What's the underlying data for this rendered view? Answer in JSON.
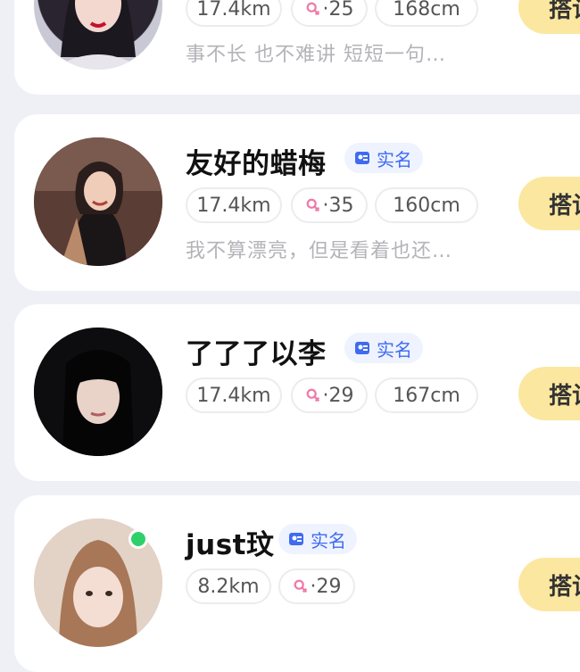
{
  "profiles": [
    {
      "name": "",
      "verified_label": "",
      "distance": "17.4km",
      "age": "25",
      "height": "168cm",
      "bio": "事不长 也不难讲 短短一句…",
      "button_label": "搭讪"
    },
    {
      "name": "友好的蜡梅",
      "verified_label": "实名",
      "distance": "17.4km",
      "age": "35",
      "height": "160cm",
      "bio": "我不算漂亮，但是看着也还…",
      "button_label": "搭讪"
    },
    {
      "name": "了了了以李",
      "verified_label": "实名",
      "distance": "17.4km",
      "age": "29",
      "height": "167cm",
      "bio": "",
      "button_label": "搭讪"
    },
    {
      "name": "just玟",
      "verified_label": "实名",
      "distance": "8.2km",
      "age": "29",
      "height": "",
      "bio": "",
      "button_label": "搭讪"
    }
  ],
  "colors": {
    "background": "#eef0f6",
    "card": "#ffffff",
    "greet_button": "#fbe7a0",
    "verify_text": "#3f6bf0",
    "online": "#2fd06a"
  },
  "icons": {
    "verify": "id-card-icon",
    "age": "female-icon",
    "online": "online-status-dot"
  }
}
